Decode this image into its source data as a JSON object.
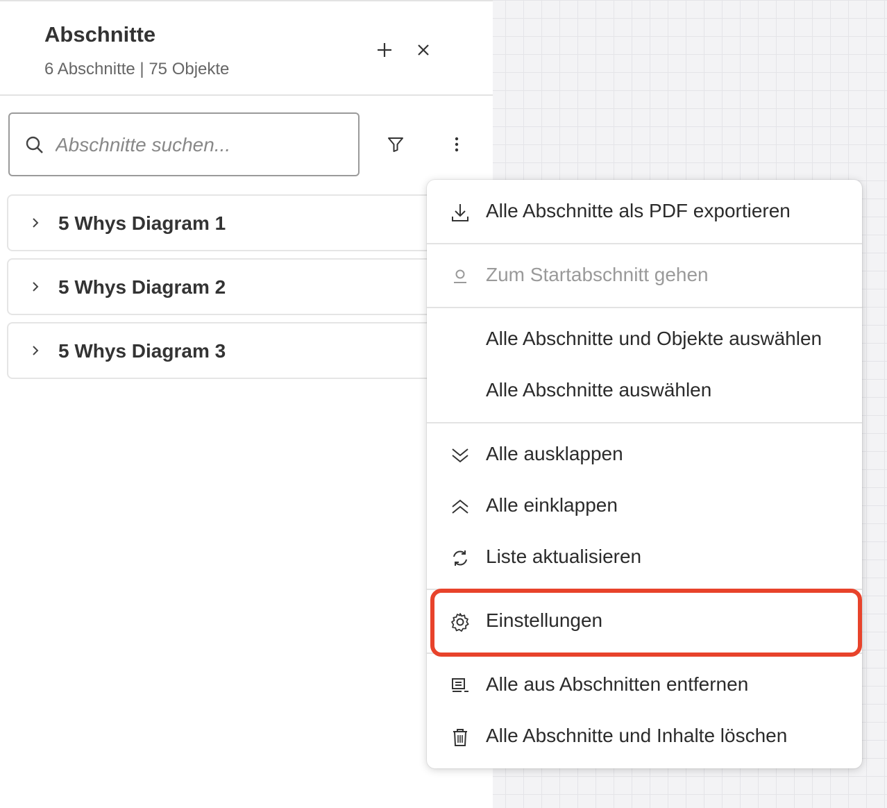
{
  "panel": {
    "title": "Abschnitte",
    "subtitle": "6 Abschnitte | 75 Objekte",
    "add_icon": "plus-icon",
    "close_icon": "close-icon"
  },
  "search": {
    "placeholder": "Abschnitte suchen...",
    "value": ""
  },
  "toolbar": {
    "filter_icon": "filter-icon",
    "more_icon": "more-vertical-icon"
  },
  "sections": [
    {
      "label": "5 Whys Diagram 1"
    },
    {
      "label": "5 Whys Diagram 2"
    },
    {
      "label": "5 Whys Diagram 3"
    }
  ],
  "menu": {
    "items": [
      {
        "label": "Alle Abschnitte als PDF exportieren",
        "icon": "download-icon",
        "enabled": true
      },
      {
        "label": "Zum Startabschnitt gehen",
        "icon": "location-pin-icon",
        "enabled": false
      },
      {
        "label": "Alle Abschnitte und Objekte auswählen",
        "icon": "",
        "enabled": true
      },
      {
        "label": "Alle Abschnitte auswählen",
        "icon": "",
        "enabled": true
      },
      {
        "label": "Alle ausklappen",
        "icon": "double-chevron-down-icon",
        "enabled": true
      },
      {
        "label": "Alle einklappen",
        "icon": "double-chevron-up-icon",
        "enabled": true
      },
      {
        "label": "Liste aktualisieren",
        "icon": "refresh-icon",
        "enabled": true
      },
      {
        "label": "Einstellungen",
        "icon": "gear-icon",
        "enabled": true
      },
      {
        "label": "Alle aus Abschnitten entfernen",
        "icon": "remove-list-icon",
        "enabled": true
      },
      {
        "label": "Alle Abschnitte und Inhalte löschen",
        "icon": "trash-icon",
        "enabled": true
      }
    ]
  },
  "colors": {
    "highlight": "#e8432b",
    "disabled_text": "#9a9a9a"
  }
}
